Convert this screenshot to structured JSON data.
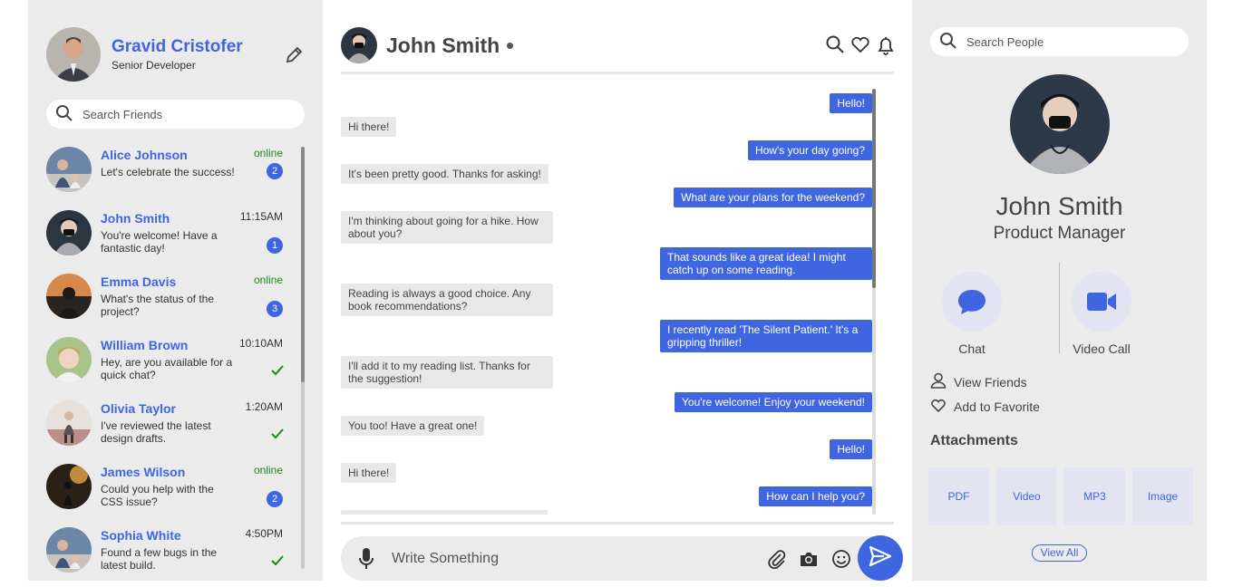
{
  "user": {
    "name": "Gravid Cristofer",
    "role": "Senior Developer"
  },
  "left_search": {
    "placeholder": "Search Friends"
  },
  "friends": [
    {
      "name": "Alice Johnson",
      "message": "Let's celebrate the success!",
      "status": "online",
      "badge": "2"
    },
    {
      "name": "John Smith",
      "message": "You're welcome! Have a fantastic day!",
      "time": "11:15AM",
      "badge": "1"
    },
    {
      "name": "Emma Davis",
      "message": "What's the status of the project?",
      "status": "online",
      "badge": "3"
    },
    {
      "name": "William Brown",
      "message": "Hey, are you available for a quick chat?",
      "time": "10:10AM"
    },
    {
      "name": "Olivia Taylor",
      "message": "I've reviewed the latest design drafts.",
      "time": "1:20AM"
    },
    {
      "name": "James Wilson",
      "message": "Could you help with the CSS issue?",
      "status": "online",
      "badge": "2"
    },
    {
      "name": "Sophia White",
      "message": "Found a few bugs in the latest build.",
      "time": "4:50PM"
    }
  ],
  "chat": {
    "name": "John Smith",
    "messages": [
      {
        "from": "out",
        "text": "Hello!"
      },
      {
        "from": "in",
        "text": "Hi there!"
      },
      {
        "from": "out",
        "text": "How's your day going?"
      },
      {
        "from": "in",
        "text": "It's been pretty good. Thanks for asking!"
      },
      {
        "from": "out",
        "text": "What are your plans for the weekend?"
      },
      {
        "from": "in",
        "text": "I'm thinking about going for a hike. How about you?"
      },
      {
        "from": "out",
        "text": "That sounds like a great idea! I might catch up on some reading."
      },
      {
        "from": "in",
        "text": "Reading is always a good choice. Any book recommendations?"
      },
      {
        "from": "out",
        "text": "I recently read 'The Silent Patient.' It's a gripping thriller!"
      },
      {
        "from": "in",
        "text": "I'll add it to my reading list. Thanks for the suggestion!"
      },
      {
        "from": "out",
        "text": "You're welcome! Enjoy your weekend!"
      },
      {
        "from": "in",
        "text": "You too! Have a great one!"
      },
      {
        "from": "out",
        "text": "Hello!"
      },
      {
        "from": "in",
        "text": "Hi there!"
      },
      {
        "from": "out",
        "text": "How can I help you?"
      }
    ],
    "input_placeholder": "Write Something"
  },
  "right_search": {
    "placeholder": "Search People"
  },
  "contact": {
    "name": "John Smith",
    "role": "Product Manager"
  },
  "actions": {
    "chat": "Chat",
    "video": "Video Call"
  },
  "links": {
    "friends": "View Friends",
    "favorite": "Add to Favorite"
  },
  "attachments": {
    "title": "Attachments",
    "items": [
      "PDF",
      "Video",
      "MP3",
      "Image"
    ],
    "view_all": "View All"
  },
  "colors": {
    "accent": "#3f66e0",
    "panel": "#ebebeb",
    "online": "#1a8a1a"
  }
}
